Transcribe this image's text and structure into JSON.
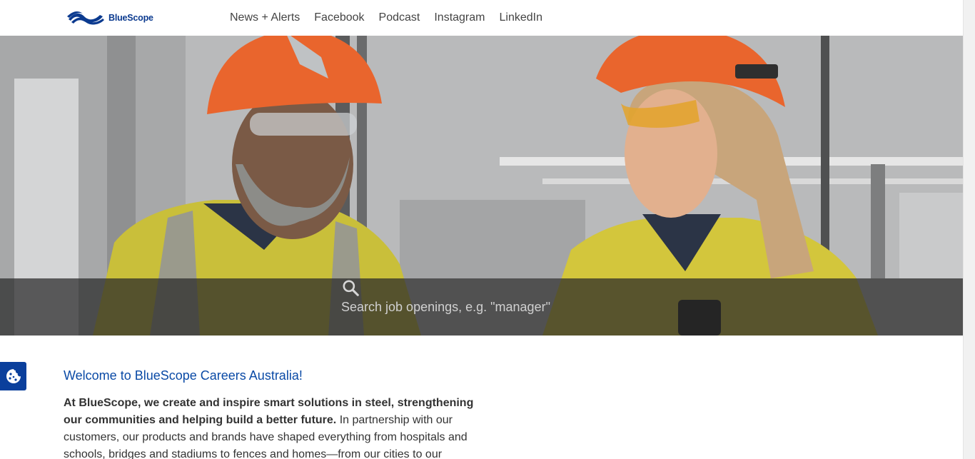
{
  "header": {
    "logo_text": "BlueScope",
    "nav": [
      {
        "label": "News + Alerts"
      },
      {
        "label": "Facebook"
      },
      {
        "label": "Podcast"
      },
      {
        "label": "Instagram"
      },
      {
        "label": "LinkedIn"
      }
    ]
  },
  "hero": {
    "search_placeholder": "Search job openings, e.g. \"manager\""
  },
  "content": {
    "welcome_title": "Welcome to BlueScope Careers Australia!",
    "intro_bold": "At BlueScope, we create and inspire smart solutions in steel, strengthening our communities and helping build a better future.",
    "intro_rest": " In partnership with our customers, our products and brands have shaped everything from hospitals and schools, bridges and stadiums to fences and homes—from our cities to our"
  },
  "colors": {
    "brand_blue": "#0a3f9c",
    "link_blue": "#0a4aa6"
  }
}
